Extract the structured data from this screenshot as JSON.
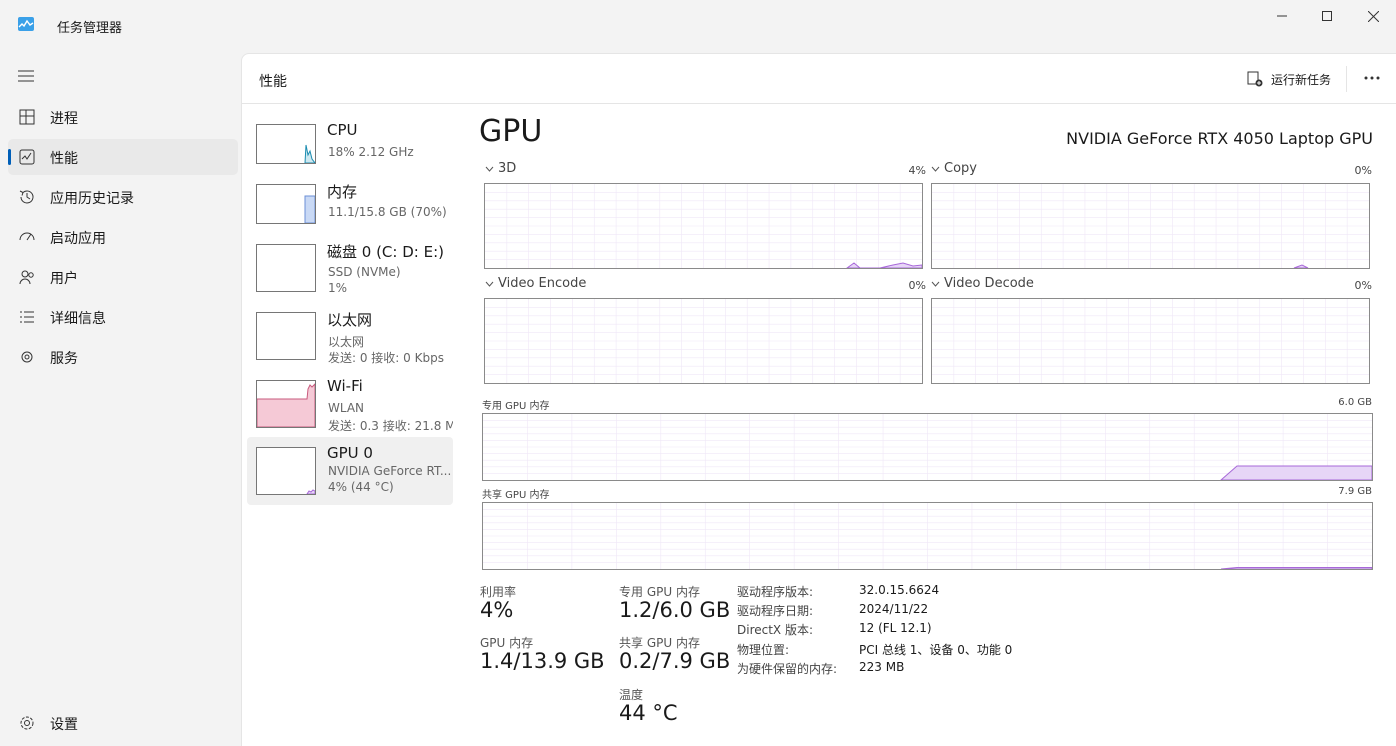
{
  "window": {
    "title": "任务管理器"
  },
  "nav": {
    "items": [
      {
        "label": "进程",
        "icon": "processes-icon"
      },
      {
        "label": "性能",
        "icon": "performance-icon",
        "active": true
      },
      {
        "label": "应用历史记录",
        "icon": "history-icon"
      },
      {
        "label": "启动应用",
        "icon": "startup-icon"
      },
      {
        "label": "用户",
        "icon": "users-icon"
      },
      {
        "label": "详细信息",
        "icon": "details-icon"
      },
      {
        "label": "服务",
        "icon": "services-icon"
      }
    ],
    "settings": "设置"
  },
  "header": {
    "title": "性能",
    "run_task": "运行新任务"
  },
  "resources": [
    {
      "name": "CPU",
      "sub1": "18%  2.12 GHz",
      "sub2": ""
    },
    {
      "name": "内存",
      "sub1": "11.1/15.8 GB (70%)",
      "sub2": ""
    },
    {
      "name": "磁盘 0 (C: D: E:)",
      "sub1": "SSD (NVMe)",
      "sub2": "1%"
    },
    {
      "name": "以太网",
      "sub1": "以太网",
      "sub2": "发送: 0 接收: 0 Kbps"
    },
    {
      "name": "Wi-Fi",
      "sub1": "WLAN",
      "sub2": "发送: 0.3 接收: 21.8 M"
    },
    {
      "name": "GPU 0",
      "sub1": "NVIDIA GeForce RT...",
      "sub2": "4% (44 °C)"
    }
  ],
  "gpu": {
    "title": "GPU",
    "model": "NVIDIA GeForce RTX 4050 Laptop GPU",
    "engines": [
      {
        "label": "3D",
        "value": "4%"
      },
      {
        "label": "Copy",
        "value": "0%"
      },
      {
        "label": "Video Encode",
        "value": "0%"
      },
      {
        "label": "Video Decode",
        "value": "0%"
      }
    ],
    "dedicated_label": "专用 GPU 内存",
    "dedicated_max": "6.0 GB",
    "shared_label": "共享 GPU 内存",
    "shared_max": "7.9 GB"
  },
  "stats": {
    "util_label": "利用率",
    "util_value": "4%",
    "ded_label": "专用 GPU 内存",
    "ded_value": "1.2/6.0 GB",
    "gpumem_label": "GPU 内存",
    "gpumem_value": "1.4/13.9 GB",
    "shared_label": "共享 GPU 内存",
    "shared_value": "0.2/7.9 GB",
    "temp_label": "温度",
    "temp_value": "44 °C"
  },
  "info": [
    {
      "key": "驱动程序版本:",
      "value": "32.0.15.6624"
    },
    {
      "key": "驱动程序日期:",
      "value": "2024/11/22"
    },
    {
      "key": "DirectX 版本:",
      "value": "12 (FL 12.1)"
    },
    {
      "key": "物理位置:",
      "value": "PCI 总线 1、设备 0、功能 0"
    },
    {
      "key": "为硬件保留的内存:",
      "value": "223 MB"
    }
  ],
  "colors": {
    "gpu": "#a768d8",
    "gpu_fill": "#e7d6f7",
    "cpu": "#1b8cb0",
    "mem": "#6b8fd6",
    "wifi": "#c85a7d",
    "accent": "#005fb8"
  }
}
